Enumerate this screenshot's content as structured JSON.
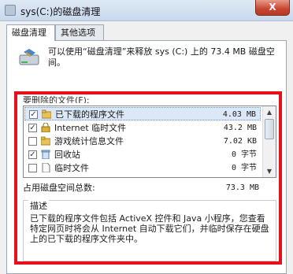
{
  "window": {
    "title": "sys(C:)的磁盘清理",
    "close_label": "X"
  },
  "tabs": [
    {
      "label": "磁盘清理"
    },
    {
      "label": "其他选项"
    }
  ],
  "intro_text": "可以使用“磁盘清理”来释放 sys (C:) 上的 73.4 MB 磁盘空间。",
  "files_to_delete_label": "要删除的文件(F):",
  "file_list": [
    {
      "label": "已下载的程序文件",
      "size": "4.03 MB",
      "checked": true,
      "icon": "folder-icon"
    },
    {
      "label": "Internet 临时文件",
      "size": "43.2 MB",
      "checked": true,
      "icon": "lock-icon"
    },
    {
      "label": "游戏统计信息文件",
      "size": "7.02 KB",
      "checked": false,
      "icon": "folder-icon"
    },
    {
      "label": "回收站",
      "size": "0 字节",
      "checked": true,
      "icon": "recycle-bin-icon"
    },
    {
      "label": "临时文件",
      "size": "0 字节",
      "checked": false,
      "icon": "file-icon"
    }
  ],
  "total_label": "占用磁盘空间总数:",
  "total_value": "73.3 MB",
  "description": {
    "title": "描述",
    "text": "已下载的程序文件包括 ActiveX 控件和 Java 小程序，您查看特定网页时将会从 Internet 自动下载它们，并临时保存在硬盘上的已下载的程序文件夹中。"
  },
  "colors": {
    "highlight_frame": "#e60f1a",
    "selected_row": "#dce8f7"
  }
}
